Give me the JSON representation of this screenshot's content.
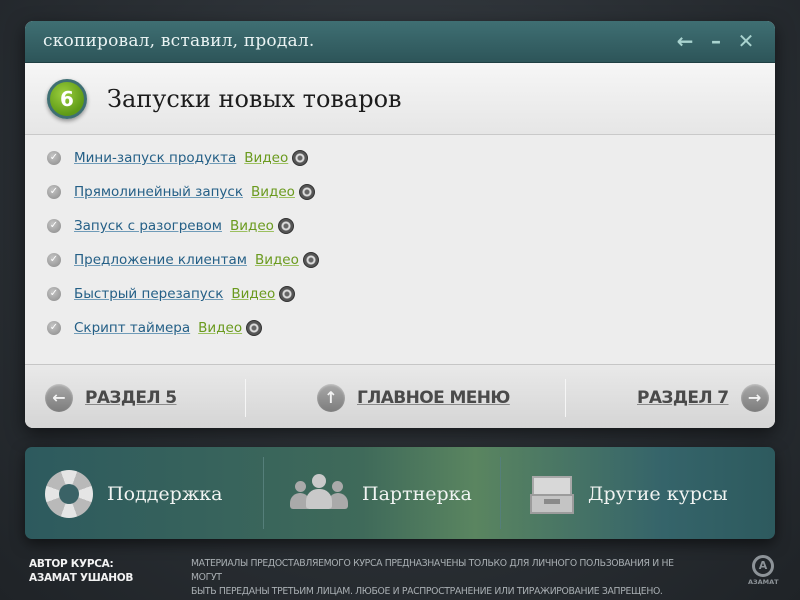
{
  "window": {
    "title": "скопировал, вставил, продал.",
    "controls": {
      "back": "←",
      "minimize": "–",
      "close": "✕"
    }
  },
  "header": {
    "number": "6",
    "title": "Запуски новых товаров"
  },
  "items": [
    {
      "label": "Мини-запуск продукта",
      "video": "Видео"
    },
    {
      "label": "Прямолинейный запуск",
      "video": "Видео"
    },
    {
      "label": "Запуск с разогревом",
      "video": "Видео"
    },
    {
      "label": "Предложение клиентам",
      "video": "Видео"
    },
    {
      "label": "Быстрый перезапуск",
      "video": "Видео"
    },
    {
      "label": "Скрипт таймера",
      "video": "Видео"
    }
  ],
  "nav": {
    "prev": "РАЗДЕЛ 5",
    "home": "ГЛАВНОЕ МЕНЮ",
    "next": "РАЗДЕЛ 7"
  },
  "panel": {
    "support": "Поддержка",
    "partner": "Партнерка",
    "courses": "Другие курсы"
  },
  "footer": {
    "author_label": "АВТОР КУРСА:",
    "author_name": "АЗАМАТ УШАНОВ",
    "notice_line1": "МАТЕРИАЛЫ ПРЕДОСТАВЛЯЕМОГО КУРСА ПРЕДНАЗНАЧЕНЫ ТОЛЬКО ДЛЯ ЛИЧНОГО ПОЛЬЗОВАНИЯ И НЕ МОГУТ",
    "notice_line2": "БЫТЬ ПЕРЕДАНЫ ТРЕТЬИМ ЛИЦАМ. ЛЮБОЕ И РАСПРОСТРАНЕНИЕ ИЛИ ТИРАЖИРОВАНИЕ ЗАПРЕЩЕНО.",
    "logo_letter": "А",
    "logo_text": "АЗАМАТ"
  },
  "icons": {
    "check": "check-icon",
    "video": "film-reel-icon",
    "support": "lifebuoy-icon",
    "partner": "people-icon",
    "courses": "inbox-tray-icon"
  },
  "colors": {
    "accent": "#3f6f73",
    "badge": "#6fae22",
    "link": "#245f86",
    "video_link": "#6a9a1e"
  }
}
